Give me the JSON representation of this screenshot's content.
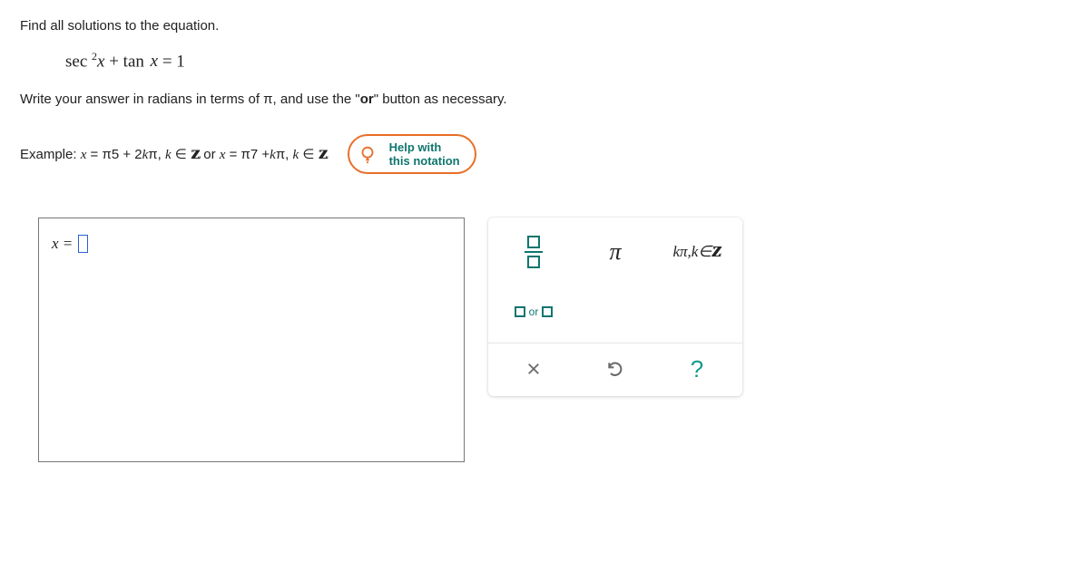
{
  "prompt": "Find all solutions to the equation.",
  "equation": {
    "lhs_prefix": "sec",
    "lhs_exp": "2",
    "lhs_var": "x",
    "plus": "+ tan",
    "lhs_var2": "x",
    "eq": "=",
    "rhs": "1"
  },
  "instruction_pre": "Write your answer in radians in terms of ",
  "instruction_pi": "π",
  "instruction_post": ", and use the \"",
  "instruction_bold": "or",
  "instruction_tail": "\" button as necessary.",
  "example": {
    "label": "Example: ",
    "part1": "x = π5 + 2kπ, k ∈ ",
    "z1": "Z",
    "or": " or ",
    "part2": "x = π7 +kπ, k ∈ ",
    "z2": "Z"
  },
  "help": {
    "line1": "Help with",
    "line2": "this notation"
  },
  "answer": {
    "lhs": "x ="
  },
  "keypad": {
    "pi": "π",
    "kpi": "kπ, k∈",
    "kz": "Z",
    "or": "or",
    "clear": "✕",
    "undo": "↺",
    "hint": "?"
  }
}
